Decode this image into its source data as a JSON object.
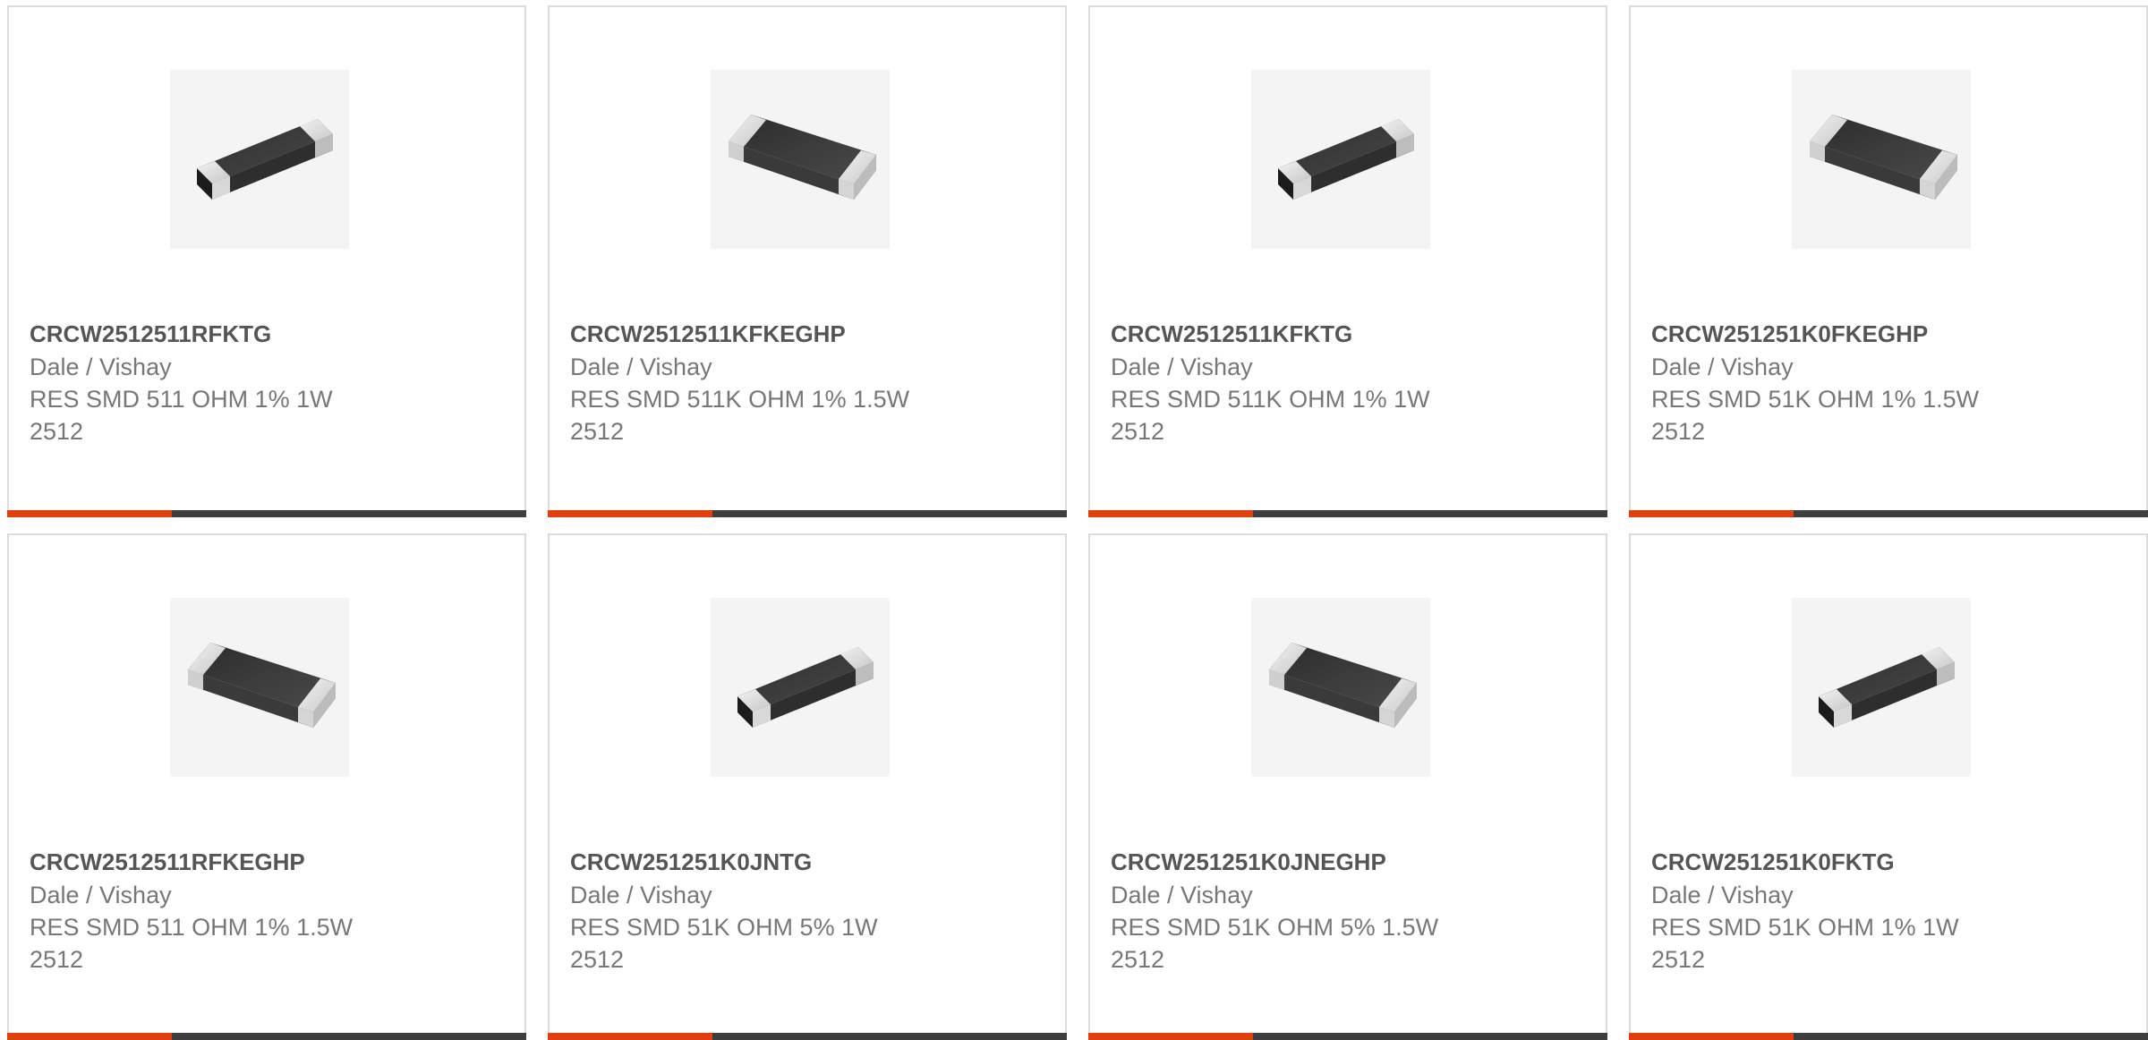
{
  "products": [
    {
      "part_number": "CRCW2512511RFKTG",
      "manufacturer": "Dale / Vishay",
      "description": "RES SMD 511 OHM 1% 1W",
      "package": "2512",
      "image_icon": "smd-resistor-chip-icon"
    },
    {
      "part_number": "CRCW2512511KFKEGHP",
      "manufacturer": "Dale / Vishay",
      "description": "RES SMD 511K OHM 1% 1.5W",
      "package": "2512",
      "image_icon": "smd-resistor-chip-icon"
    },
    {
      "part_number": "CRCW2512511KFKTG",
      "manufacturer": "Dale / Vishay",
      "description": "RES SMD 511K OHM 1% 1W",
      "package": "2512",
      "image_icon": "smd-resistor-chip-icon"
    },
    {
      "part_number": "CRCW251251K0FKEGHP",
      "manufacturer": "Dale / Vishay",
      "description": "RES SMD 51K OHM 1% 1.5W",
      "package": "2512",
      "image_icon": "smd-resistor-chip-icon"
    },
    {
      "part_number": "CRCW2512511RFKEGHP",
      "manufacturer": "Dale / Vishay",
      "description": "RES SMD 511 OHM 1% 1.5W",
      "package": "2512",
      "image_icon": "smd-resistor-chip-icon"
    },
    {
      "part_number": "CRCW251251K0JNTG",
      "manufacturer": "Dale / Vishay",
      "description": "RES SMD 51K OHM 5% 1W",
      "package": "2512",
      "image_icon": "smd-resistor-chip-icon"
    },
    {
      "part_number": "CRCW251251K0JNEGHP",
      "manufacturer": "Dale / Vishay",
      "description": "RES SMD 51K OHM 5% 1.5W",
      "package": "2512",
      "image_icon": "smd-resistor-chip-icon"
    },
    {
      "part_number": "CRCW251251K0FKTG",
      "manufacturer": "Dale / Vishay",
      "description": "RES SMD 51K OHM 1% 1W",
      "package": "2512",
      "image_icon": "smd-resistor-chip-icon"
    }
  ],
  "colors": {
    "accent": "#e0400f",
    "bar": "#3e3e3e",
    "part_number": "#555555",
    "text": "#777777",
    "border": "#dcdcdc"
  }
}
